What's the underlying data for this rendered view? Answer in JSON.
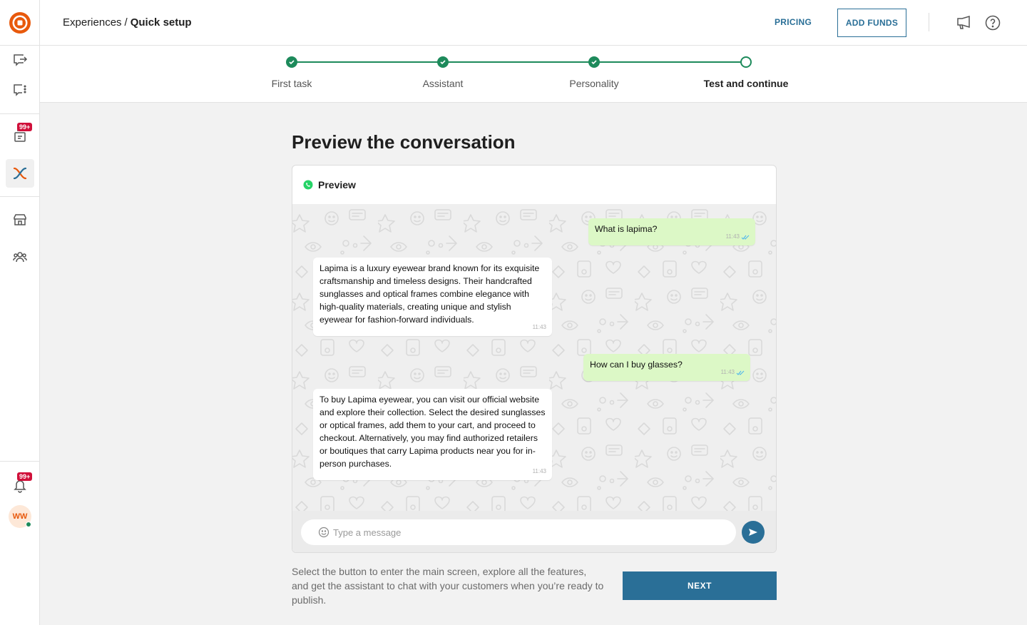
{
  "breadcrumb": {
    "parent": "Experiences",
    "separator": "/",
    "current": "Quick setup"
  },
  "header": {
    "pricing_label": "PRICING",
    "add_funds_label": "ADD FUNDS"
  },
  "sidebar": {
    "notifications_badge": "99+",
    "tasks_badge": "99+",
    "avatar_initials": "WW"
  },
  "stepper": {
    "steps": [
      {
        "label": "First task",
        "status": "done"
      },
      {
        "label": "Assistant",
        "status": "done"
      },
      {
        "label": "Personality",
        "status": "done"
      },
      {
        "label": "Test and continue",
        "status": "current"
      }
    ]
  },
  "main": {
    "title": "Preview the conversation"
  },
  "preview": {
    "header_label": "Preview",
    "messages": [
      {
        "direction": "out",
        "text": "What is lapima?",
        "time": "11:43"
      },
      {
        "direction": "in",
        "text": "Lapima is a luxury eyewear brand known for its exquisite craftsmanship and timeless designs. Their handcrafted sunglasses and optical frames combine elegance with high-quality materials, creating unique and stylish eyewear for fashion-forward individuals.",
        "time": "11:43"
      },
      {
        "direction": "out",
        "text": "How can I buy glasses?",
        "time": "11:43"
      },
      {
        "direction": "in",
        "text": "To buy Lapima eyewear, you can visit our official website and explore their collection. Select the desired sunglasses or optical frames, add them to your cart, and proceed to checkout. Alternatively, you may find authorized retailers or boutiques that carry Lapima products near you for in-person purchases.",
        "time": "11:43"
      }
    ],
    "input_placeholder": "Type a message"
  },
  "footer": {
    "text": "Select the button to enter the main screen, explore all the features, and get the assistant to chat with your customers when you’re ready to publish.",
    "next_label": "NEXT"
  },
  "colors": {
    "accent": "#2a6f97",
    "success": "#1d8a5b",
    "badge": "#d0103a",
    "logo": "#e8590c",
    "outgoing_bubble": "#dcf8c6"
  }
}
